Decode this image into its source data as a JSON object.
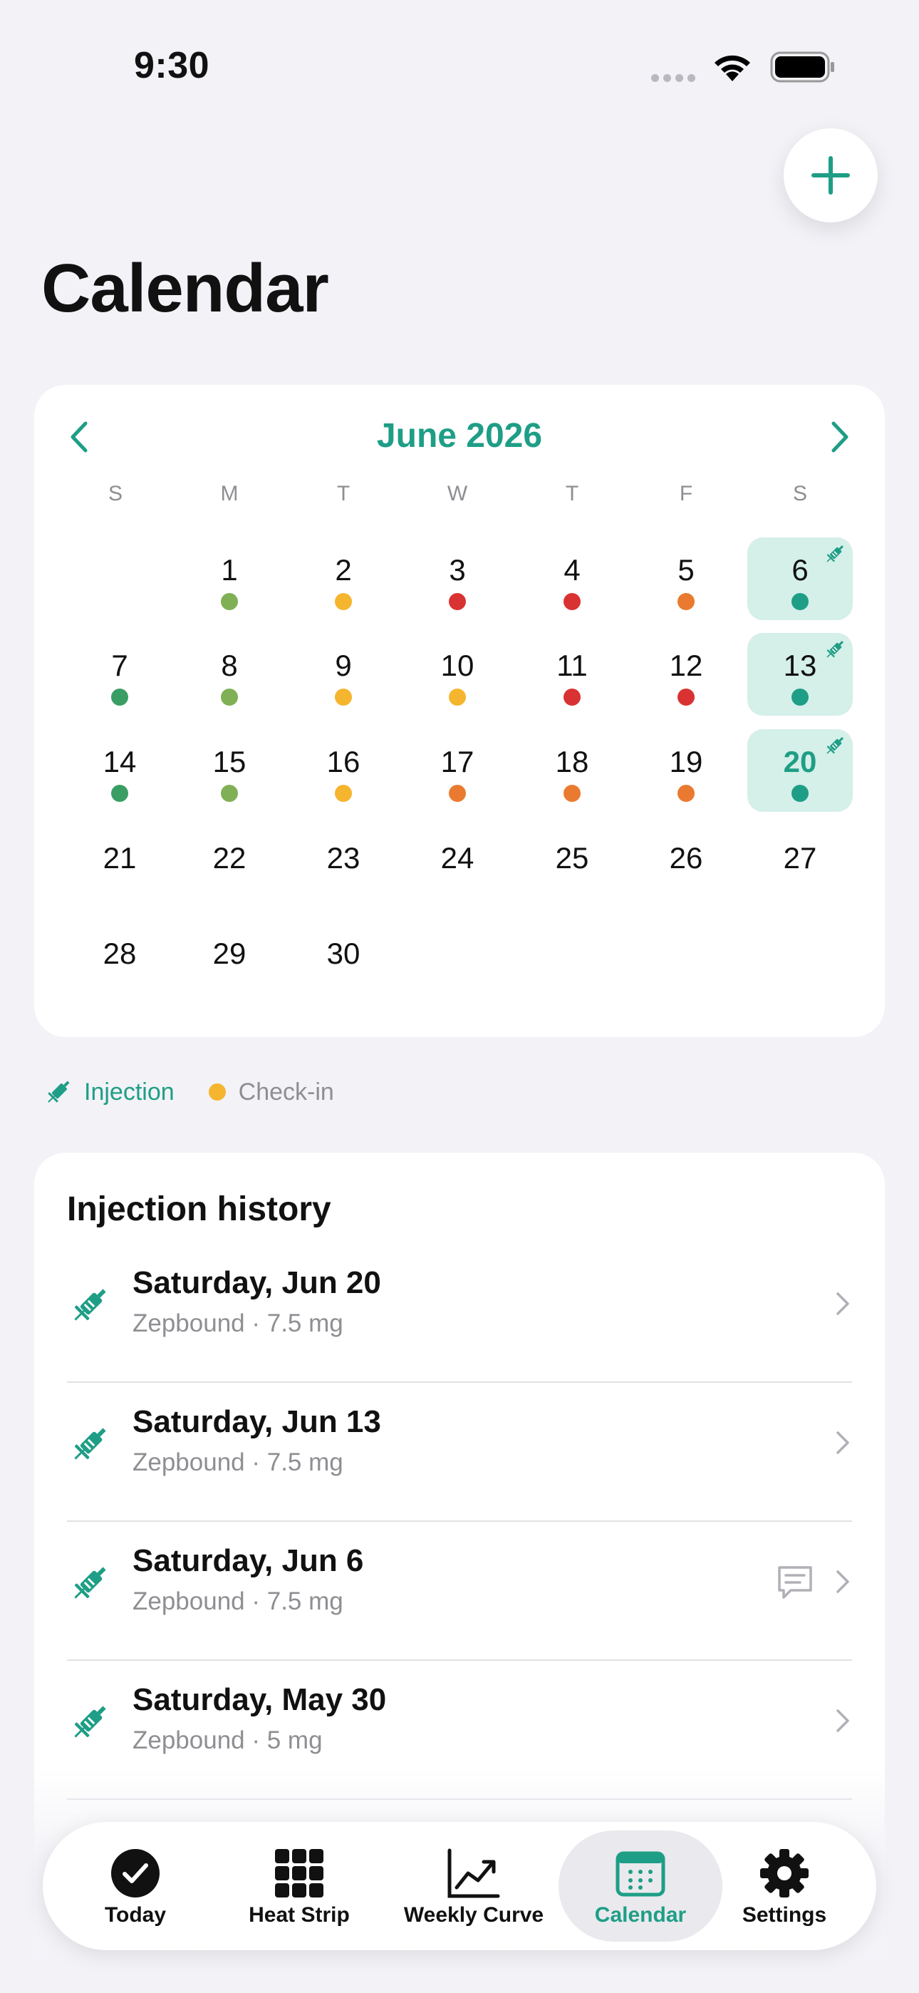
{
  "status_bar": {
    "time": "9:30"
  },
  "page": {
    "title": "Calendar"
  },
  "colors": {
    "accent": "#1e9e86",
    "green": "#3a9e64",
    "light_green": "#7fb055",
    "yellow": "#f5b52e",
    "orange": "#ea7a30",
    "red": "#d93232",
    "teal": "#1e9e86"
  },
  "calendar": {
    "month_title": "June 2026",
    "weekdays": [
      "S",
      "M",
      "T",
      "W",
      "T",
      "F",
      "S"
    ],
    "days": [
      {
        "d": 1,
        "dot": "light_green"
      },
      {
        "d": 2,
        "dot": "yellow"
      },
      {
        "d": 3,
        "dot": "red"
      },
      {
        "d": 4,
        "dot": "red"
      },
      {
        "d": 5,
        "dot": "orange"
      },
      {
        "d": 6,
        "dot": "teal",
        "injection": true
      },
      {
        "d": 7,
        "dot": "green"
      },
      {
        "d": 8,
        "dot": "light_green"
      },
      {
        "d": 9,
        "dot": "yellow"
      },
      {
        "d": 10,
        "dot": "yellow"
      },
      {
        "d": 11,
        "dot": "red"
      },
      {
        "d": 12,
        "dot": "red"
      },
      {
        "d": 13,
        "dot": "teal",
        "injection": true
      },
      {
        "d": 14,
        "dot": "green"
      },
      {
        "d": 15,
        "dot": "light_green"
      },
      {
        "d": 16,
        "dot": "yellow"
      },
      {
        "d": 17,
        "dot": "orange"
      },
      {
        "d": 18,
        "dot": "orange"
      },
      {
        "d": 19,
        "dot": "orange"
      },
      {
        "d": 20,
        "dot": "teal",
        "injection": true,
        "today": true
      },
      {
        "d": 21
      },
      {
        "d": 22
      },
      {
        "d": 23
      },
      {
        "d": 24
      },
      {
        "d": 25
      },
      {
        "d": 26
      },
      {
        "d": 27
      },
      {
        "d": 28
      },
      {
        "d": 29
      },
      {
        "d": 30
      }
    ],
    "first_weekday_index": 1
  },
  "legend": {
    "injection_label": "Injection",
    "checkin_label": "Check-in"
  },
  "history": {
    "title": "Injection history",
    "rows": [
      {
        "date": "Saturday, Jun 20",
        "detail": "Zepbound · 7.5 mg",
        "has_note": false
      },
      {
        "date": "Saturday, Jun 13",
        "detail": "Zepbound · 7.5 mg",
        "has_note": false
      },
      {
        "date": "Saturday, Jun 6",
        "detail": "Zepbound · 7.5 mg",
        "has_note": true
      },
      {
        "date": "Saturday, May 30",
        "detail": "Zepbound · 5 mg",
        "has_note": false
      }
    ]
  },
  "tabs": [
    {
      "label": "Today",
      "icon": "checkmark-circle-icon"
    },
    {
      "label": "Heat Strip",
      "icon": "grid-icon"
    },
    {
      "label": "Weekly Curve",
      "icon": "trend-chart-icon"
    },
    {
      "label": "Calendar",
      "icon": "calendar-icon",
      "active": true
    },
    {
      "label": "Settings",
      "icon": "gear-icon"
    }
  ]
}
